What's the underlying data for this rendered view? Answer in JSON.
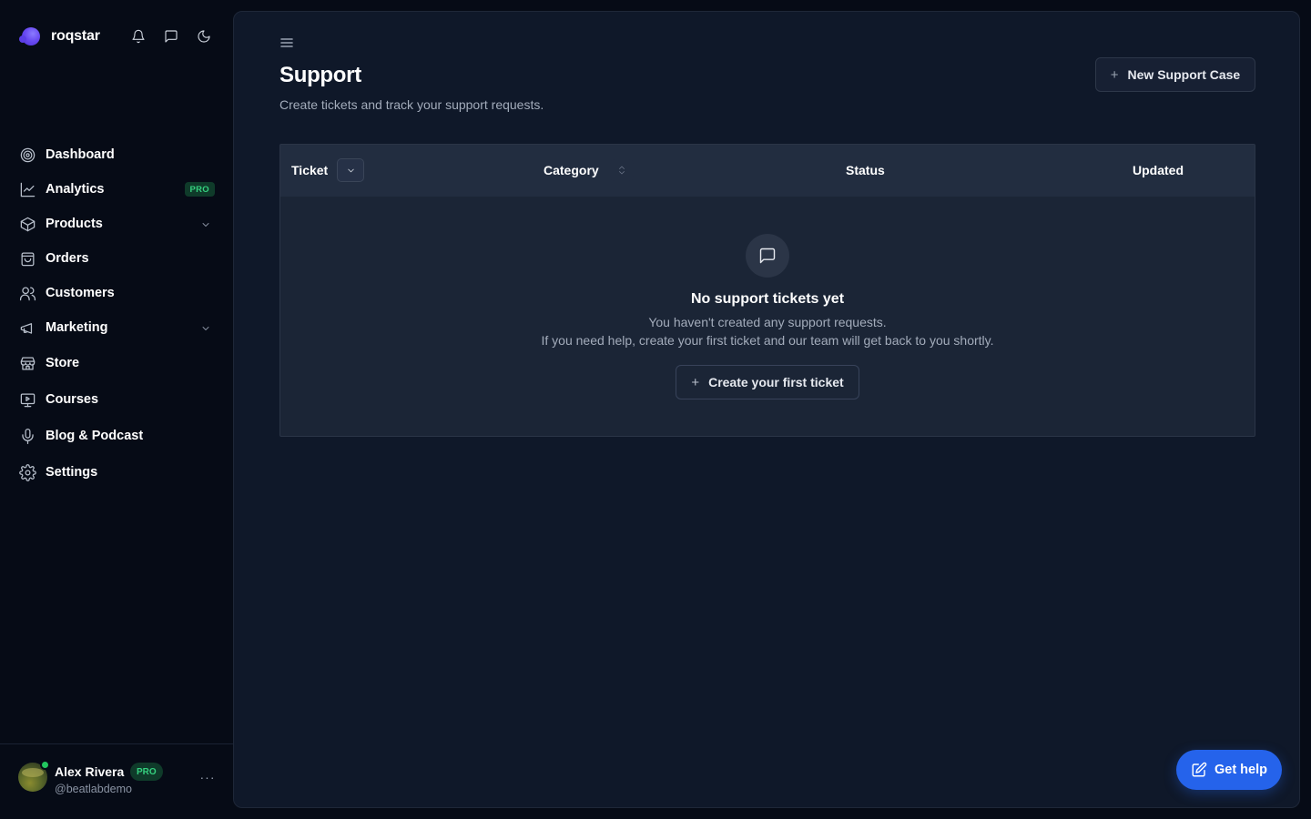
{
  "brand": {
    "name": "roqstar"
  },
  "nav": {
    "items": [
      {
        "label": "Dashboard",
        "icon": "target-icon"
      },
      {
        "label": "Analytics",
        "icon": "line-chart-icon",
        "badge": "PRO"
      },
      {
        "label": "Products",
        "icon": "box-icon",
        "expandable": true
      },
      {
        "label": "Orders",
        "icon": "shopping-bag-icon"
      },
      {
        "label": "Customers",
        "icon": "users-icon"
      },
      {
        "label": "Marketing",
        "icon": "megaphone-icon",
        "expandable": true
      },
      {
        "label": "Store",
        "icon": "store-icon"
      },
      {
        "label": "Courses",
        "icon": "presentation-icon"
      },
      {
        "label": "Blog & Podcast",
        "icon": "microphone-icon"
      },
      {
        "label": "Settings",
        "icon": "gear-icon"
      }
    ]
  },
  "user": {
    "name": "Alex Rivera",
    "badge": "PRO",
    "handle": "@beatlabdemo",
    "menu": "···"
  },
  "page": {
    "title": "Support",
    "subtitle": "Create tickets and track your support requests.",
    "new_case_label": "New Support Case"
  },
  "table": {
    "columns": [
      "Ticket",
      "Category",
      "Status",
      "Updated"
    ]
  },
  "empty_state": {
    "title": "No support tickets yet",
    "line1": "You haven't created any support requests.",
    "line2": "If you need help, create your first ticket and our team will get back to you shortly.",
    "button_label": "Create your first ticket"
  },
  "help": {
    "label": "Get help"
  },
  "colors": {
    "accent": "#2563eb",
    "pro_badge_text": "#35d07f",
    "pro_badge_bg": "#0f3b2a",
    "online": "#22c55e"
  }
}
